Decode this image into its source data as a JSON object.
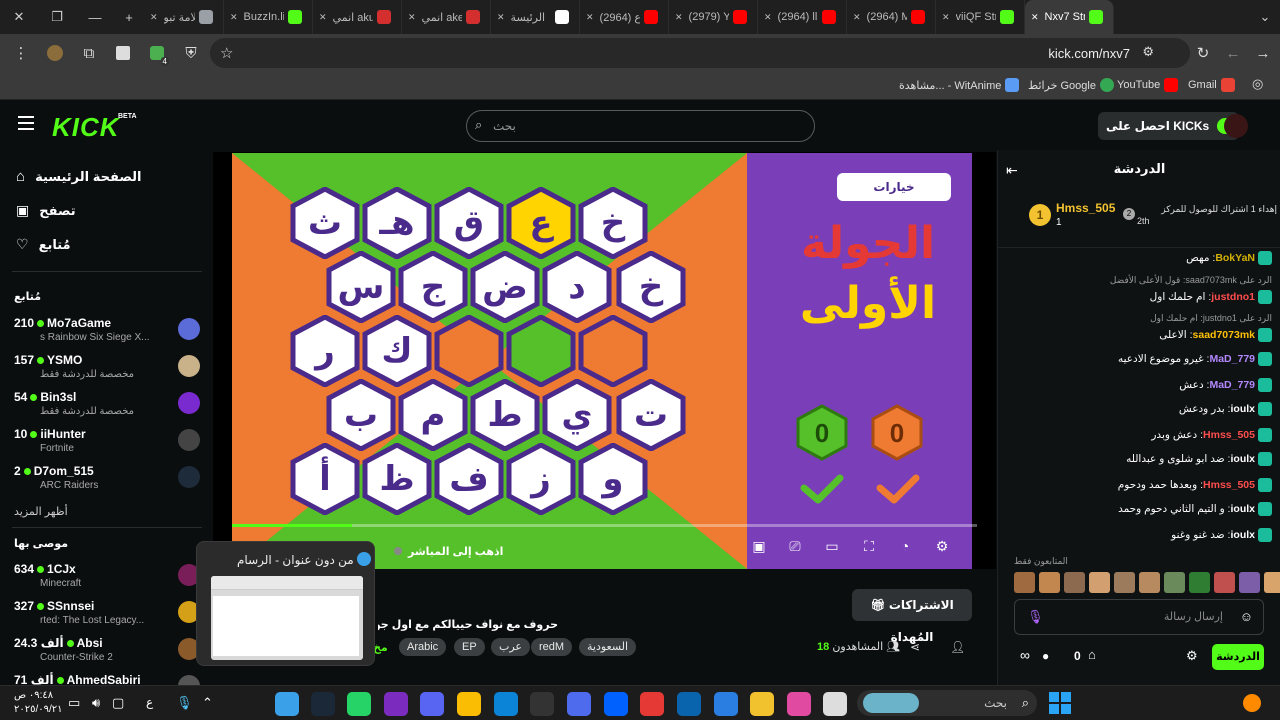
{
  "browser": {
    "tabs": [
      {
        "label": "علامة تبو",
        "color": "#9aa0a6"
      },
      {
        "label": "BuzzIn.li",
        "color": "#53fc18"
      },
      {
        "label": "انمي aku",
        "color": "#d32f2f"
      },
      {
        "label": "انمي ake",
        "color": "#d32f2f"
      },
      {
        "label": "الرئيسة",
        "color": "#ffffff"
      },
      {
        "label": "(2964) ع",
        "color": "#ff0000"
      },
      {
        "label": "(2979) Y",
        "color": "#ff0000"
      },
      {
        "label": "(2964) ll",
        "color": "#ff0000"
      },
      {
        "label": "(2964) M",
        "color": "#ff0000"
      },
      {
        "label": "viiQF Str",
        "color": "#53fc18"
      },
      {
        "label": "Nxv7 Str",
        "color": "#53fc18"
      }
    ],
    "url": "kick.com/nxv7",
    "bookmarks": [
      {
        "label": "Gmail",
        "color": "#ea4335"
      },
      {
        "label": "YouTube",
        "color": "#ff0000"
      },
      {
        "label": "خرائط Google",
        "color": "#34a853"
      },
      {
        "label": "مشاهدة... - WitAnime",
        "color": "#5a9cf5"
      }
    ],
    "extension_badge": "4"
  },
  "kick": {
    "logo": "KICK",
    "logo_badge": "BETA",
    "search_placeholder": "بحث",
    "get_kicks_label": "احصل على KICKs"
  },
  "sidebar": {
    "nav": [
      {
        "label": "الصفحة الرئيسية",
        "icon": "home-icon"
      },
      {
        "label": "تصفح",
        "icon": "browse-icon"
      },
      {
        "label": "مُتابع",
        "icon": "heart-icon"
      }
    ],
    "following_heading": "مُتابع",
    "following": [
      {
        "count": "210",
        "name": "Mo7aGame",
        "sub": "s Rainbow Six Siege X...",
        "color": "#5b6bd8"
      },
      {
        "count": "157",
        "name": "YSMO",
        "sub": "مخصصة للدردشة فقط",
        "color": "#c9b28a"
      },
      {
        "count": "54",
        "name": "Bin3sl",
        "sub": "مخصصة للدردشة فقط",
        "color": "#7a2bd0"
      },
      {
        "count": "10",
        "name": "iiHunter",
        "sub": "Fortnite",
        "color": "#444444"
      },
      {
        "count": "2",
        "name": "D7om_515",
        "sub": "ARC Raiders",
        "color": "#1e2b3a"
      }
    ],
    "show_more": "أظهر المزيد",
    "recommended_heading": "موصى بها",
    "recommended": [
      {
        "count": "634",
        "name": "1CJx",
        "sub": "Minecraft",
        "color": "#7a1e5a"
      },
      {
        "count": "327",
        "name": "SSnnsei",
        "sub": "rted: The Lost Legacy...",
        "color": "#d4a017"
      },
      {
        "count": "24.3 ألف",
        "name": "Absi",
        "sub": "Counter-Strike 2",
        "color": "#8b5a2b"
      },
      {
        "count": "71 ألف",
        "name": "AhmedSabiri",
        "sub": "",
        "color": "#555555"
      }
    ]
  },
  "game": {
    "options_label": "خيارات",
    "round_title_line1": "الجولة",
    "round_title_line2": "الأولى",
    "score_green": "0",
    "score_orange": "0",
    "rows": [
      [
        "خ",
        "ع",
        "ق",
        "هـ",
        "ث"
      ],
      [
        "خ",
        "د",
        "ض",
        "ج",
        "س"
      ],
      [
        "",
        "",
        "",
        "ك",
        "ر"
      ],
      [
        "ت",
        "ي",
        "ط",
        "م",
        "ب"
      ],
      [
        "و",
        "ز",
        "ف",
        "ظ",
        "أ"
      ]
    ],
    "highlight": "ع"
  },
  "player": {
    "go_live": "اذهب إلى المباشر"
  },
  "stream": {
    "title": "حروف مع نواف حييالكم مع اول جولة بالبطو",
    "category_cut": "مخ",
    "tags": [
      "Arabic",
      "EP",
      "عرب",
      "redM",
      "السعودية"
    ],
    "gift_subs_label": "الاشتراكات المُهداة",
    "viewers_label": "المشاهدون",
    "viewers_count": "18"
  },
  "chat": {
    "title": "الدردشة",
    "pinned": {
      "user": "Hmss_505",
      "count": "1",
      "rank_badge": "2",
      "rank_suffix": "2th",
      "text": "إهداء 1 اشتراك للوصول للمركز"
    },
    "messages": [
      {
        "user": "BokYaN",
        "text": "مهص",
        "color": "#d4b106",
        "reply": ""
      },
      {
        "user": "",
        "text": "",
        "color": "#9a9a9a",
        "reply": "الرد على saad7073mk: قول الأعلى الأفضل"
      },
      {
        "user": "justdno1",
        "text": "ام حلمك اول",
        "color": "#ff4d4d",
        "reply": ""
      },
      {
        "user": "",
        "text": "",
        "color": "#9a9a9a",
        "reply": "الرد على justdno1: ام حلمك اول"
      },
      {
        "user": "saad7073mk",
        "text": "الاعلى",
        "color": "#ffc107",
        "reply": ""
      },
      {
        "user": "MaD_779",
        "text": "غيرو موضوع الادعيه",
        "color": "#b388ff",
        "reply": ""
      },
      {
        "user": "MaD_779",
        "text": "دعش",
        "color": "#b388ff",
        "reply": ""
      },
      {
        "user": "ioulx",
        "text": "بدر ودعش",
        "color": "#ffffff",
        "reply": ""
      },
      {
        "user": "Hmss_505",
        "text": "دعش وبدر",
        "color": "#ff4d4d",
        "reply": ""
      },
      {
        "user": "ioulx",
        "text": "ضد ابو شلوى و عبدالله",
        "color": "#ffffff",
        "reply": ""
      },
      {
        "user": "Hmss_505",
        "text": "وبعدها حمد ودحوم",
        "color": "#ff4d4d",
        "reply": ""
      },
      {
        "user": "ioulx",
        "text": "و التيم الثاني دحوم وحمد",
        "color": "#ffffff",
        "reply": ""
      },
      {
        "user": "ioulx",
        "text": "ضد غنو وغنو",
        "color": "#ffffff",
        "reply": ""
      }
    ],
    "followers_only": "المتابعون فقط",
    "input_placeholder": "إرسال رسالة",
    "send_label": "الدردشة",
    "points": "0"
  },
  "popup": {
    "title": "من دون عنوان - الرسام"
  },
  "taskbar": {
    "time": "٠٩:٤٨ ص",
    "date": "٢٠٢٥/٠٩/٢١",
    "search_placeholder": "بحث"
  }
}
